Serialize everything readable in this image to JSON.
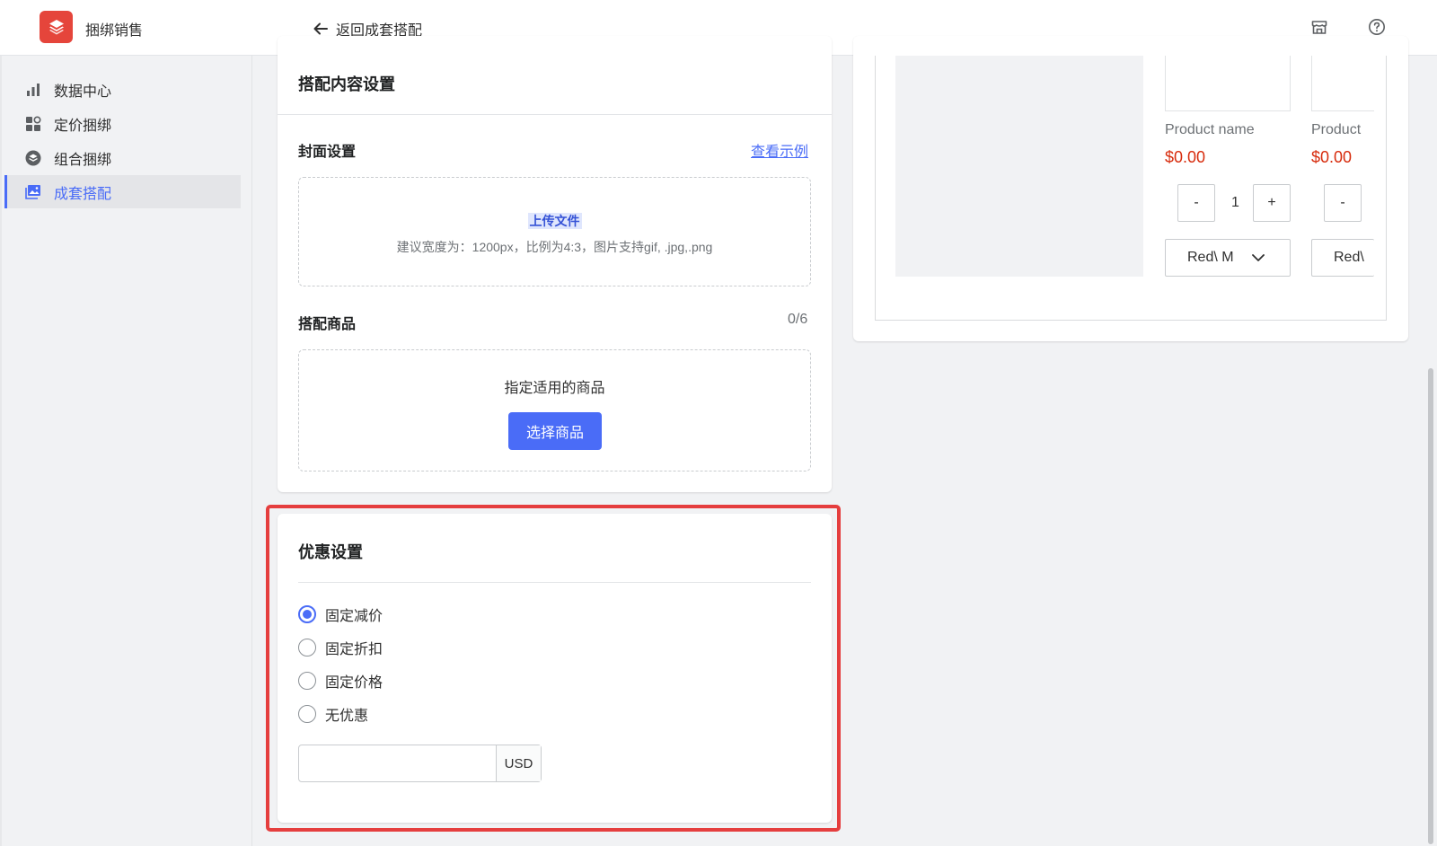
{
  "header": {
    "app_name": "捆绑销售",
    "back_label": "返回成套搭配",
    "icons": [
      "store-icon",
      "help-icon"
    ]
  },
  "sidebar": {
    "items": [
      {
        "label": "数据中心",
        "icon": "bar-chart-icon",
        "active": false
      },
      {
        "label": "定价捆绑",
        "icon": "apps-grid-icon",
        "active": false
      },
      {
        "label": "组合捆绑",
        "icon": "bundle-icon",
        "active": false
      },
      {
        "label": "成套搭配",
        "icon": "image-icon",
        "active": true
      }
    ]
  },
  "content_card": {
    "title": "搭配内容设置",
    "cover": {
      "label": "封面设置",
      "example_link": "查看示例",
      "upload_label": "上传文件",
      "upload_hint": "建议宽度为：1200px，比例为4:3，图片支持gif, .jpg,.png"
    },
    "products": {
      "label": "搭配商品",
      "count": "0/6",
      "prompt": "指定适用的商品",
      "select_button": "选择商品"
    }
  },
  "discount_card": {
    "title": "优惠设置",
    "options": [
      {
        "label": "固定减价",
        "checked": true
      },
      {
        "label": "固定折扣",
        "checked": false
      },
      {
        "label": "固定价格",
        "checked": false
      },
      {
        "label": "无优惠",
        "checked": false
      }
    ],
    "amount_value": "",
    "currency": "USD"
  },
  "preview": {
    "products": [
      {
        "name": "Product name",
        "price": "$0.00",
        "qty": "1",
        "minus": "-",
        "plus": "+",
        "variant": "Red\\ M"
      },
      {
        "name": "Product",
        "price": "$0.00",
        "minus": "-",
        "variant": "Red\\"
      }
    ]
  },
  "colors": {
    "accent": "#4a6cf7",
    "brand": "#e5453b",
    "price": "#d72c0d",
    "highlight": "#e53e3e"
  }
}
